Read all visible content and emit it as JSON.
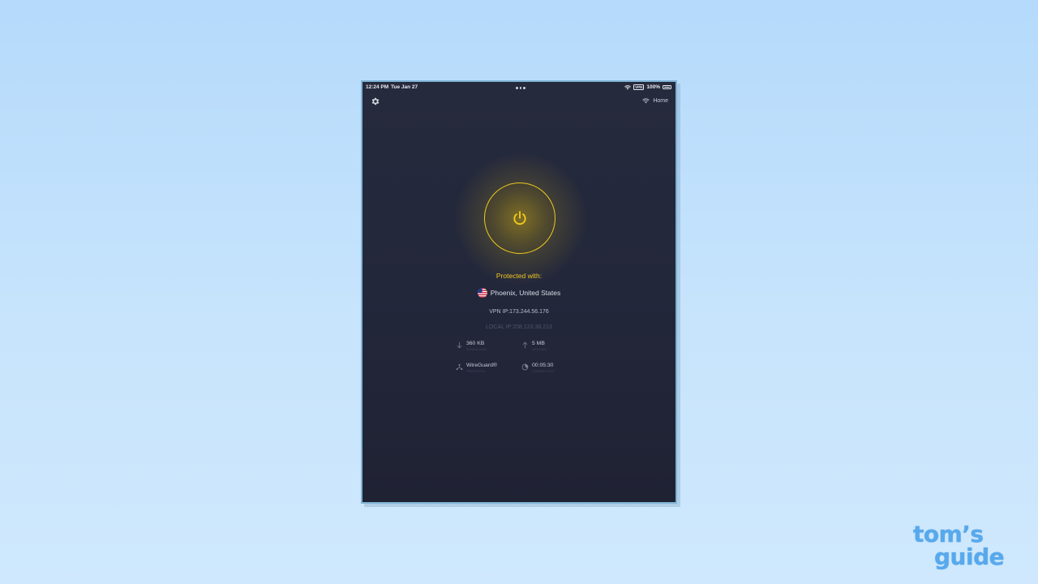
{
  "status_bar": {
    "time": "12:24 PM",
    "date": "Tue Jan 27",
    "vpn_badge": "VPN",
    "battery": "100%"
  },
  "header": {
    "settings_icon": "gear-icon",
    "network_icon": "wifi-icon",
    "network_label": "Home"
  },
  "connection": {
    "power_icon": "power-icon",
    "status_color": "#f0c91c",
    "protected_label": "Protected with:",
    "location": "Phoenix, United States",
    "flag_icon": "us-flag-icon",
    "vpn_ip": "VPN IP:173.244.56.176",
    "local_ip": "LOCAL IP:208.123.38.213"
  },
  "stats": {
    "download": {
      "value": "360 KB",
      "label": "Download",
      "icon": "arrow-down-icon"
    },
    "upload": {
      "value": "5 MB",
      "label": "Upload",
      "icon": "arrow-up-icon"
    },
    "protocol": {
      "value": "WireGuard®",
      "label": "Protocol",
      "icon": "protocol-icon"
    },
    "duration": {
      "value": "00:05:30",
      "label": "Connected",
      "icon": "timer-icon"
    }
  },
  "watermark": {
    "line1": "tom’s",
    "line2": "guide",
    "color": "#57a9ec"
  }
}
